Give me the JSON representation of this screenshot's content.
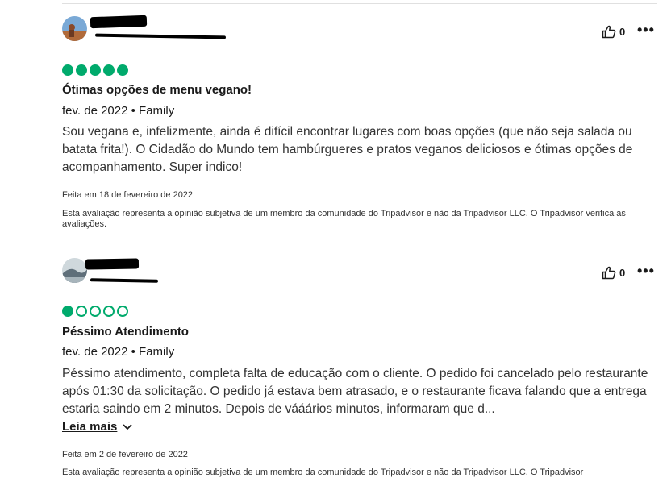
{
  "reviews": [
    {
      "helpful_count": "0",
      "rating": 5,
      "title": "Ótimas opções de menu vegano!",
      "date_trip": "fev. de 2022 • Family",
      "body": "Sou vegana e, infelizmente, ainda é difícil encontrar lugares com boas opções (que não seja salada ou batata frita!). O Cidadão do Mundo tem hambúrgueres e pratos veganos deliciosos e ótimas opções de acompanhamento. Super indico!",
      "written_date": "Feita em 18 de fevereiro de 2022",
      "disclaimer": "Esta avaliação representa a opinião subjetiva de um membro da comunidade do Tripadvisor e não da Tripadvisor LLC. O Tripadvisor verifica as avaliações."
    },
    {
      "helpful_count": "0",
      "rating": 1,
      "title": "Péssimo Atendimento",
      "date_trip": "fev. de 2022 • Family",
      "body": "Péssimo atendimento, completa falta de educação com o cliente. O pedido foi cancelado pelo restaurante após 01:30 da solicitação. O pedido já estava bem atrasado, e o restaurante ficava falando que a entrega estaria saindo em 2 minutos. Depois de vááários minutos, informaram que d...",
      "read_more": "Leia mais",
      "written_date": "Feita em 2 de fevereiro de 2022",
      "disclaimer": "Esta avaliação representa a opinião subjetiva de um membro da comunidade do Tripadvisor e não da Tripadvisor LLC. O Tripadvisor"
    }
  ],
  "icons": {
    "thumbs_up": "thumbs-up-icon",
    "more": "more-options-icon",
    "chevron": "chevron-down-icon"
  },
  "colors": {
    "bubble": "#00aa6c"
  }
}
